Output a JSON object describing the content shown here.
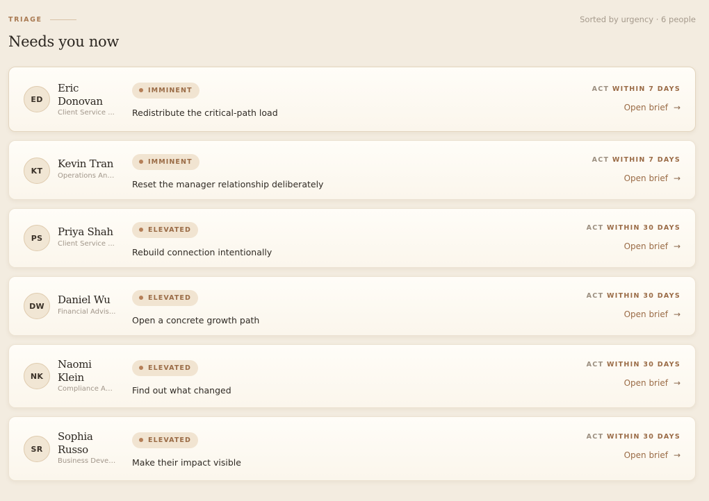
{
  "header": {
    "eyebrow": "TRIAGE",
    "meta": "Sorted by urgency · 6 people",
    "title": "Needs you now"
  },
  "colors": {
    "background": "#f3ece0",
    "card": "#fffdf8",
    "accent": "#9a6b46",
    "badge_bg": "#f1e4d1"
  },
  "icons": {
    "badge_dot": "dot-icon",
    "open_arrow": "arrow-right-icon"
  },
  "people": [
    {
      "initials": "ED",
      "name_line1": "Eric",
      "name_line2": "Donovan",
      "role": "Client Service ...",
      "badge": "IMMINENT",
      "action": "Redistribute the critical-path load",
      "act_prefix": "ACT",
      "act_window": "WITHIN 7 DAYS",
      "cta": "Open brief"
    },
    {
      "initials": "KT",
      "name_line1": "Kevin Tran",
      "name_line2": "",
      "role": "Operations Ana...",
      "badge": "IMMINENT",
      "action": "Reset the manager relationship deliberately",
      "act_prefix": "ACT",
      "act_window": "WITHIN 7 DAYS",
      "cta": "Open brief"
    },
    {
      "initials": "PS",
      "name_line1": "Priya Shah",
      "name_line2": "",
      "role": "Client Service ...",
      "badge": "ELEVATED",
      "action": "Rebuild connection intentionally",
      "act_prefix": "ACT",
      "act_window": "WITHIN 30 DAYS",
      "cta": "Open brief"
    },
    {
      "initials": "DW",
      "name_line1": "Daniel Wu",
      "name_line2": "",
      "role": "Financial Advis...",
      "badge": "ELEVATED",
      "action": "Open a concrete growth path",
      "act_prefix": "ACT",
      "act_window": "WITHIN 30 DAYS",
      "cta": "Open brief"
    },
    {
      "initials": "NK",
      "name_line1": "Naomi",
      "name_line2": "Klein",
      "role": "Compliance An...",
      "badge": "ELEVATED",
      "action": "Find out what changed",
      "act_prefix": "ACT",
      "act_window": "WITHIN 30 DAYS",
      "cta": "Open brief"
    },
    {
      "initials": "SR",
      "name_line1": "Sophia",
      "name_line2": "Russo",
      "role": "Business Devel...",
      "badge": "ELEVATED",
      "action": "Make their impact visible",
      "act_prefix": "ACT",
      "act_window": "WITHIN 30 DAYS",
      "cta": "Open brief"
    }
  ]
}
